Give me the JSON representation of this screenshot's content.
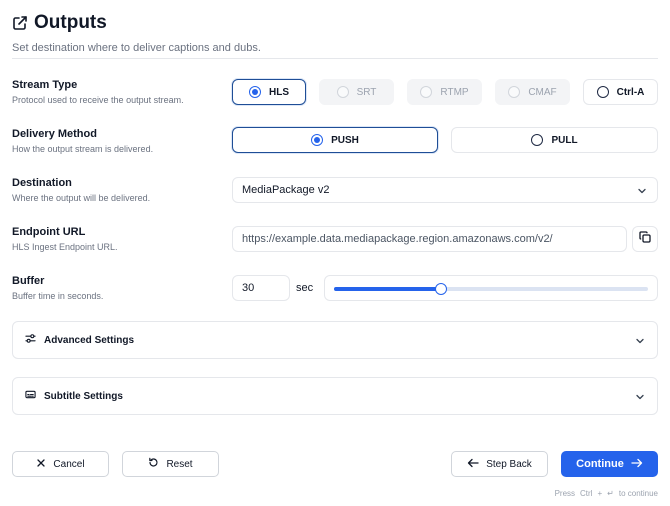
{
  "header": {
    "icon": "external-link-icon",
    "title": "Outputs",
    "subtitle": "Set destination where to deliver captions and dubs."
  },
  "stream_type": {
    "label": "Stream Type",
    "description": "Protocol used to receive the output stream.",
    "options": [
      {
        "label": "HLS",
        "state": "selected"
      },
      {
        "label": "SRT",
        "state": "disabled"
      },
      {
        "label": "RTMP",
        "state": "disabled"
      },
      {
        "label": "CMAF",
        "state": "disabled"
      },
      {
        "label": "Ctrl-A",
        "state": "enabled"
      }
    ]
  },
  "delivery_method": {
    "label": "Delivery Method",
    "description": "How the output stream is delivered.",
    "options": [
      {
        "label": "PUSH",
        "state": "selected"
      },
      {
        "label": "PULL",
        "state": "enabled"
      }
    ]
  },
  "destination": {
    "label": "Destination",
    "description": "Where the output will be delivered.",
    "value": "MediaPackage v2"
  },
  "endpoint": {
    "label": "Endpoint URL",
    "description": "HLS Ingest Endpoint URL.",
    "value": "https://example.data.mediapackage.region.amazonaws.com/v2/",
    "copy_icon": "copy-icon"
  },
  "buffer": {
    "label": "Buffer",
    "description": "Buffer time in seconds.",
    "value": "30",
    "unit": "sec",
    "slider_fraction": 0.34
  },
  "sections": [
    {
      "label": "Advanced Settings",
      "icon": "sliders-icon"
    },
    {
      "label": "Subtitle Settings",
      "icon": "subtitles-icon"
    }
  ],
  "footer": {
    "cancel_label": "Cancel",
    "reset_label": "Reset",
    "back_label": "Step Back",
    "continue_label": "Continue",
    "hint_press": "Press",
    "hint_key": "Ctrl",
    "hint_plus": "+",
    "hint_enter": "↵",
    "hint_suffix": "to continue"
  },
  "colors": {
    "accent": "#2563eb",
    "selected_border": "#1f4e96"
  }
}
